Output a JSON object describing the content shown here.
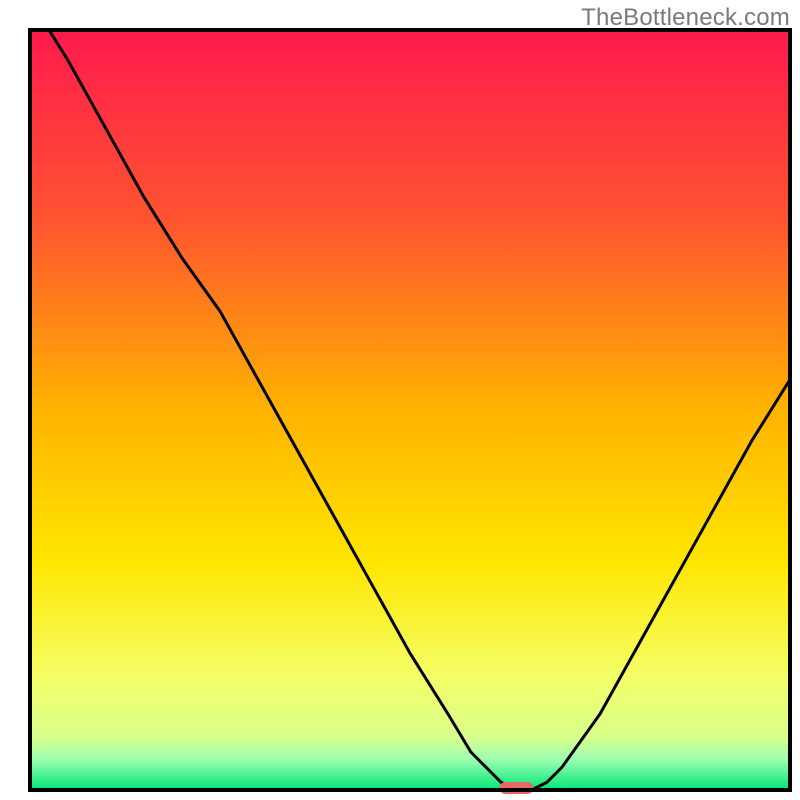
{
  "watermark": "TheBottleneck.com",
  "chart_data": {
    "type": "line",
    "title": "",
    "xlabel": "",
    "ylabel": "",
    "xlim": [
      0,
      100
    ],
    "ylim": [
      0,
      100
    ],
    "x": [
      2.5,
      5,
      10,
      15,
      20,
      25,
      30,
      35,
      40,
      45,
      50,
      55,
      58,
      60,
      62,
      64,
      66,
      68,
      70,
      75,
      80,
      85,
      90,
      95,
      100
    ],
    "values": [
      100,
      96,
      87,
      78,
      70,
      63,
      54,
      45,
      36,
      27,
      18,
      10,
      5,
      3,
      1,
      0,
      0,
      1,
      3,
      10,
      19,
      28,
      37,
      46,
      54
    ],
    "notch_marker": {
      "x_center": 64,
      "y": 0,
      "color": "#e46a6a"
    },
    "background_gradient_stops": [
      {
        "offset": 0.0,
        "color": "#ff1a4d"
      },
      {
        "offset": 0.25,
        "color": "#ff5430"
      },
      {
        "offset": 0.5,
        "color": "#ffb300"
      },
      {
        "offset": 0.7,
        "color": "#ffe600"
      },
      {
        "offset": 0.85,
        "color": "#f4ff66"
      },
      {
        "offset": 0.93,
        "color": "#d9ff8c"
      },
      {
        "offset": 0.96,
        "color": "#9cffb0"
      },
      {
        "offset": 1.0,
        "color": "#00e676"
      }
    ],
    "frame_color": "#000000",
    "line_color": "#000000",
    "line_width": 3
  }
}
